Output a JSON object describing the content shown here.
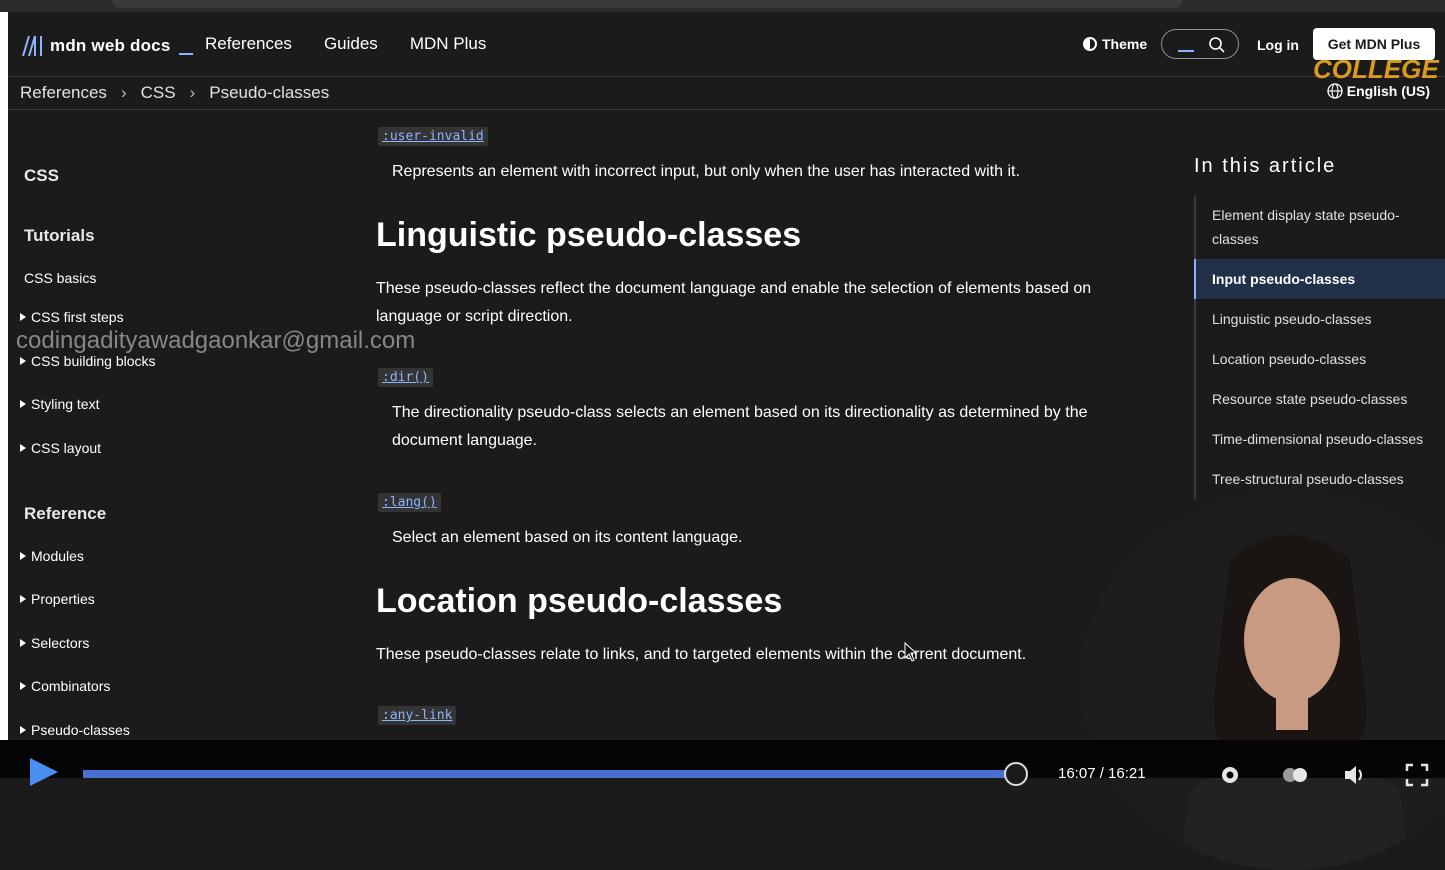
{
  "header": {
    "logo_text": "mdn web docs",
    "nav": [
      "References",
      "Guides",
      "MDN Plus"
    ],
    "theme_label": "Theme",
    "login_label": "Log in",
    "cta_label": "Get MDN Plus",
    "overlay_text": "COLLEGE"
  },
  "breadcrumb": {
    "items": [
      "References",
      "CSS",
      "Pseudo-classes"
    ],
    "separator": "›",
    "language": "English (US)"
  },
  "sidebar": {
    "section_title": "CSS",
    "tutorials_heading": "Tutorials",
    "tutorial_items": [
      "CSS basics",
      "CSS first steps",
      "CSS building blocks",
      "Styling text",
      "CSS layout"
    ],
    "reference_heading": "Reference",
    "reference_items": [
      "Modules",
      "Properties",
      "Selectors",
      "Combinators",
      "Pseudo-classes"
    ]
  },
  "watermark": "codingadityawadgaonkar@gmail.com",
  "content": {
    "user_invalid_code": ":user-invalid",
    "user_invalid_desc": "Represents an element with incorrect input, but only when the user has interacted with it.",
    "linguistic_heading": "Linguistic pseudo-classes",
    "linguistic_para": "These pseudo-classes reflect the document language and enable the selection of elements based on language or script direction.",
    "dir_code": ":dir()",
    "dir_desc": "The directionality pseudo-class selects an element based on its directionality as determined by the document language.",
    "lang_code": ":lang()",
    "lang_desc": "Select an element based on its content language.",
    "location_heading": "Location pseudo-classes",
    "location_para": "These pseudo-classes relate to links, and to targeted elements within the current document.",
    "any_link_code": ":any-link"
  },
  "toc": {
    "title": "In this article",
    "items": [
      "Element display state pseudo-classes",
      "Input pseudo-classes",
      "Linguistic pseudo-classes",
      "Location pseudo-classes",
      "Resource state pseudo-classes",
      "Time-dimensional pseudo-classes",
      "Tree-structural pseudo-classes"
    ],
    "active_index": 1
  },
  "player": {
    "time": "16:07 / 16:21",
    "progress": 0.99
  },
  "colors": {
    "accent": "#8cb4ff",
    "background": "#1b1b1b",
    "progress": "#4a6fd0"
  }
}
